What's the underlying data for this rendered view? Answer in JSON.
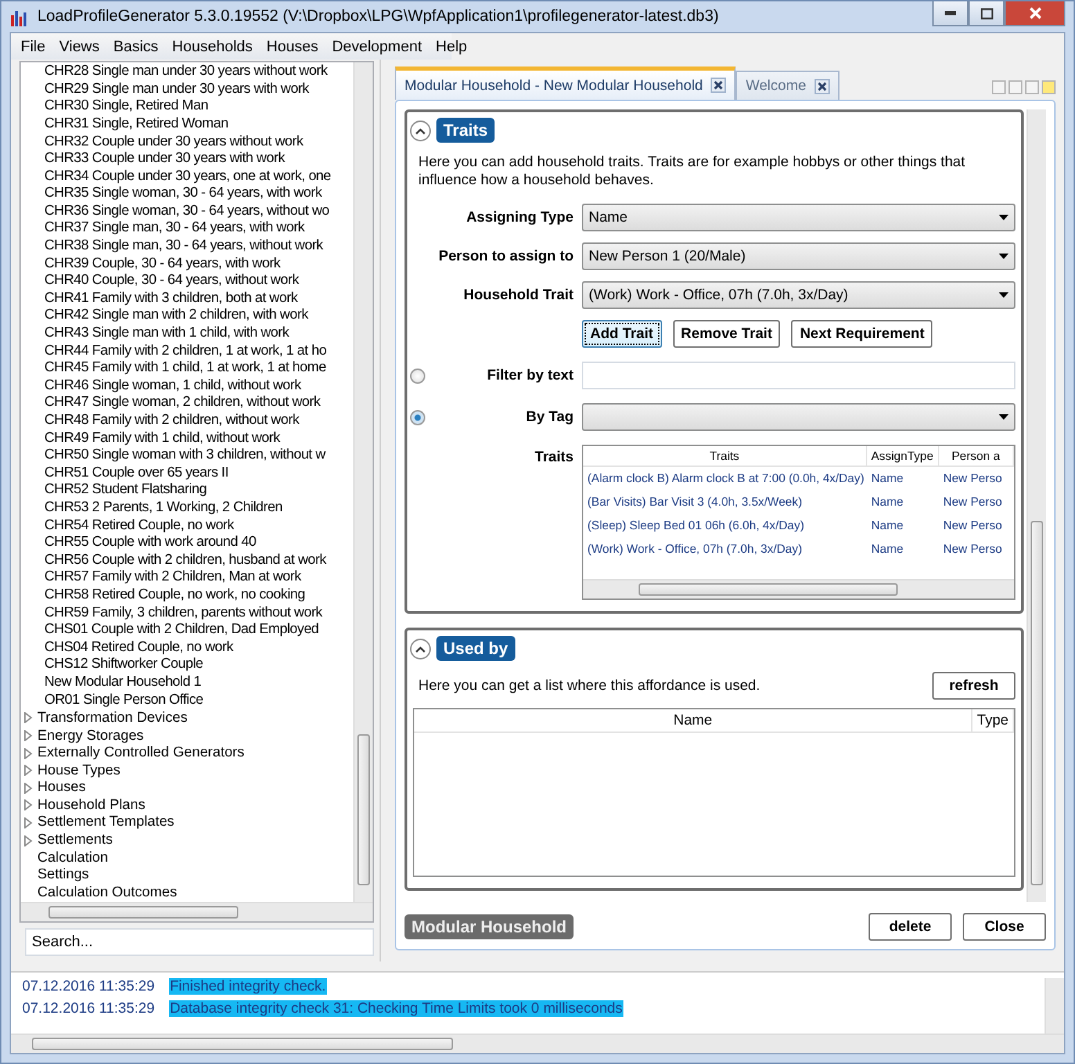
{
  "window": {
    "title": "LoadProfileGenerator 5.3.0.19552 (V:\\Dropbox\\LPG\\WpfApplication1\\profilegenerator-latest.db3)"
  },
  "menu": [
    "File",
    "Views",
    "Basics",
    "Households",
    "Houses",
    "Development",
    "Help"
  ],
  "tree": {
    "leaf_items": [
      "CHR28 Single man under 30 years without work",
      "CHR29 Single man under 30 years with work",
      "CHR30 Single, Retired Man",
      "CHR31 Single, Retired Woman",
      "CHR32 Couple under 30 years without work",
      "CHR33 Couple under 30 years with work",
      "CHR34 Couple under 30 years, one at work, one",
      "CHR35 Single woman, 30 - 64 years, with work",
      "CHR36 Single woman, 30 - 64 years, without wo",
      "CHR37 Single man, 30 - 64 years, with work",
      "CHR38 Single man, 30 - 64 years, without work",
      "CHR39 Couple, 30 - 64 years, with work",
      "CHR40 Couple, 30 - 64 years, without work",
      "CHR41 Family with 3 children, both at work",
      "CHR42 Single man with 2 children, with work",
      "CHR43 Single man with 1 child, with work",
      "CHR44 Family with 2 children, 1 at work, 1 at ho",
      "CHR45 Family with 1 child, 1 at work, 1 at home",
      "CHR46 Single woman, 1 child, without work",
      "CHR47 Single woman, 2 children, without work",
      "CHR48 Family with 2 children, without work",
      "CHR49 Family with 1 child, without work",
      "CHR50 Single woman with 3 children, without w",
      "CHR51 Couple over 65 years II",
      "CHR52 Student Flatsharing",
      "CHR53 2 Parents, 1 Working, 2 Children",
      "CHR54 Retired Couple, no work",
      "CHR55 Couple with work around 40",
      "CHR56 Couple with 2 children, husband at work",
      "CHR57 Family with 2 Children, Man at work",
      "CHR58 Retired Couple, no work, no cooking",
      "CHR59 Family, 3 children, parents without work",
      "CHS01 Couple with 2 Children, Dad Employed",
      "CHS04 Retired Couple, no work",
      "CHS12 Shiftworker Couple",
      "New Modular Household 1",
      "OR01 Single Person Office"
    ],
    "items": [
      {
        "label": "Transformation Devices",
        "expandable": true
      },
      {
        "label": "Energy Storages",
        "expandable": true
      },
      {
        "label": "Externally Controlled Generators",
        "expandable": true
      },
      {
        "label": "House Types",
        "expandable": true
      },
      {
        "label": "Houses",
        "expandable": true
      },
      {
        "label": "Household Plans",
        "expandable": true
      },
      {
        "label": "Settlement Templates",
        "expandable": true
      },
      {
        "label": "Settlements",
        "expandable": true
      },
      {
        "label": "Calculation",
        "expandable": false
      },
      {
        "label": "Settings",
        "expandable": false
      },
      {
        "label": "Calculation Outcomes",
        "expandable": false
      }
    ]
  },
  "search": {
    "placeholder": "Search..."
  },
  "tabs": [
    {
      "label": "Modular Household - New Modular Household",
      "selected": true
    },
    {
      "label": "Welcome",
      "selected": false
    }
  ],
  "traits_section": {
    "title": "Traits",
    "expanded": true,
    "description": "Here you can add household traits. Traits are for example hobbys or other things that influence how a household behaves.",
    "fields": [
      {
        "label": "Assigning Type",
        "value": "Name"
      },
      {
        "label": "Person to assign to",
        "value": "New Person 1 (20/Male)"
      },
      {
        "label": "Household Trait",
        "value": "(Work) Work - Office, 07h (7.0h, 3x/Day)"
      }
    ],
    "buttons": [
      {
        "label": "Add Trait",
        "focused": true
      },
      {
        "label": "Remove Trait",
        "focused": false
      },
      {
        "label": "Next Requirement",
        "focused": false
      }
    ],
    "filters": [
      {
        "kind": "text",
        "label": "Filter by text",
        "selected": false
      },
      {
        "kind": "select",
        "label": "By Tag",
        "selected": true
      }
    ],
    "table_label": "Traits",
    "table": {
      "columns": [
        "Traits",
        "AssignType",
        "Person a"
      ],
      "rows": [
        [
          "(Alarm clock B) Alarm clock B at 7:00 (0.0h, 4x/Day)",
          "Name",
          "New Perso"
        ],
        [
          "(Bar Visits) Bar Visit 3 (4.0h, 3.5x/Week)",
          "Name",
          "New Perso"
        ],
        [
          "(Sleep) Sleep Bed 01 06h (6.0h, 4x/Day)",
          "Name",
          "New Perso"
        ],
        [
          "(Work) Work - Office, 07h (7.0h, 3x/Day)",
          "Name",
          "New Perso"
        ]
      ]
    }
  },
  "used_by_section": {
    "title": "Used by",
    "expanded": true,
    "description": "Here you can get a list where this affordance is used.",
    "refresh_button": "refresh",
    "table": {
      "columns": [
        "Name",
        "Type"
      ]
    }
  },
  "footer": {
    "badge": "Modular Household",
    "buttons": [
      "delete",
      "Close"
    ]
  },
  "log": [
    {
      "time": "07.12.2016 11:35:29",
      "message": "Finished integrity check."
    },
    {
      "time": "07.12.2016 11:35:29",
      "message": "Database integrity check 31: Checking Time Limits took 0 milliseconds"
    }
  ]
}
